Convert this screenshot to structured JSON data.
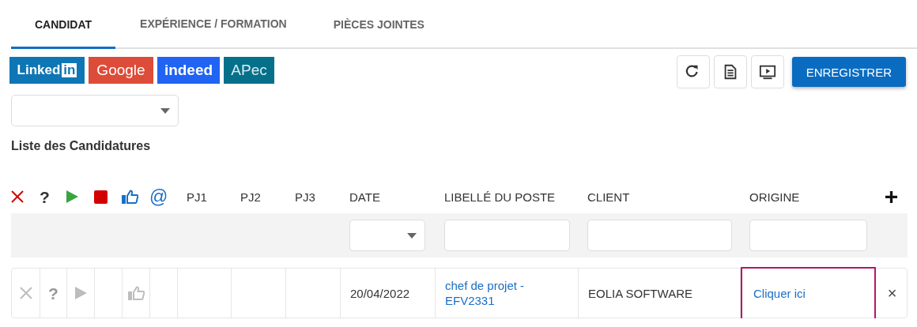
{
  "tabs": [
    {
      "label": "CANDIDAT",
      "selected": true
    },
    {
      "label": "EXPÉRIENCE / FORMATION",
      "selected": false
    },
    {
      "label": "PIÈCES JOINTES",
      "selected": false
    }
  ],
  "job_boards": [
    {
      "kind": "linkedin",
      "label": "Linked",
      "badge": "in",
      "color": "#0e76b5"
    },
    {
      "kind": "google",
      "label": "Google",
      "color": "#dd4b39"
    },
    {
      "kind": "indeed",
      "label": "indeed",
      "color": "#2164f3"
    },
    {
      "kind": "apec",
      "label": "APec",
      "color": "#06708a"
    }
  ],
  "toolbar": {
    "buttons": [
      {
        "kind": "refresh"
      },
      {
        "kind": "document"
      },
      {
        "kind": "preview"
      }
    ],
    "save_label": "ENREGISTRER"
  },
  "section_title": "Liste des Candidatures",
  "table": {
    "icon_headers": [
      {
        "kind": "reject",
        "disabled": false
      },
      {
        "kind": "question",
        "text": "?",
        "disabled": false
      },
      {
        "kind": "play",
        "disabled": false
      },
      {
        "kind": "stop",
        "disabled": false
      },
      {
        "kind": "like",
        "disabled": false
      },
      {
        "kind": "email",
        "text": "@",
        "disabled": false
      }
    ],
    "columns": [
      {
        "label": "PJ1",
        "kind": "plain"
      },
      {
        "label": "PJ2",
        "kind": "plain"
      },
      {
        "label": "PJ3",
        "kind": "plain"
      },
      {
        "label": "DATE",
        "kind": "select"
      },
      {
        "label": "LIBELLÉ DU POSTE",
        "kind": "input"
      },
      {
        "label": "CLIENT",
        "kind": "input"
      },
      {
        "label": "ORIGINE",
        "kind": "input"
      }
    ],
    "add_label": "+",
    "rows": [
      {
        "icons": [
          {
            "kind": "reject",
            "disabled": true
          },
          {
            "kind": "question",
            "text": "?",
            "disabled": true
          },
          {
            "kind": "play",
            "disabled": true
          },
          {
            "kind": "empty"
          },
          {
            "kind": "like",
            "disabled": true
          },
          {
            "kind": "empty"
          }
        ],
        "date": "20/04/2022",
        "job_title": "chef de projet - EFV2331",
        "client": "EOLIA SOFTWARE",
        "origin": "Cliquer ici",
        "highlighted": true,
        "remove": "×"
      }
    ]
  }
}
